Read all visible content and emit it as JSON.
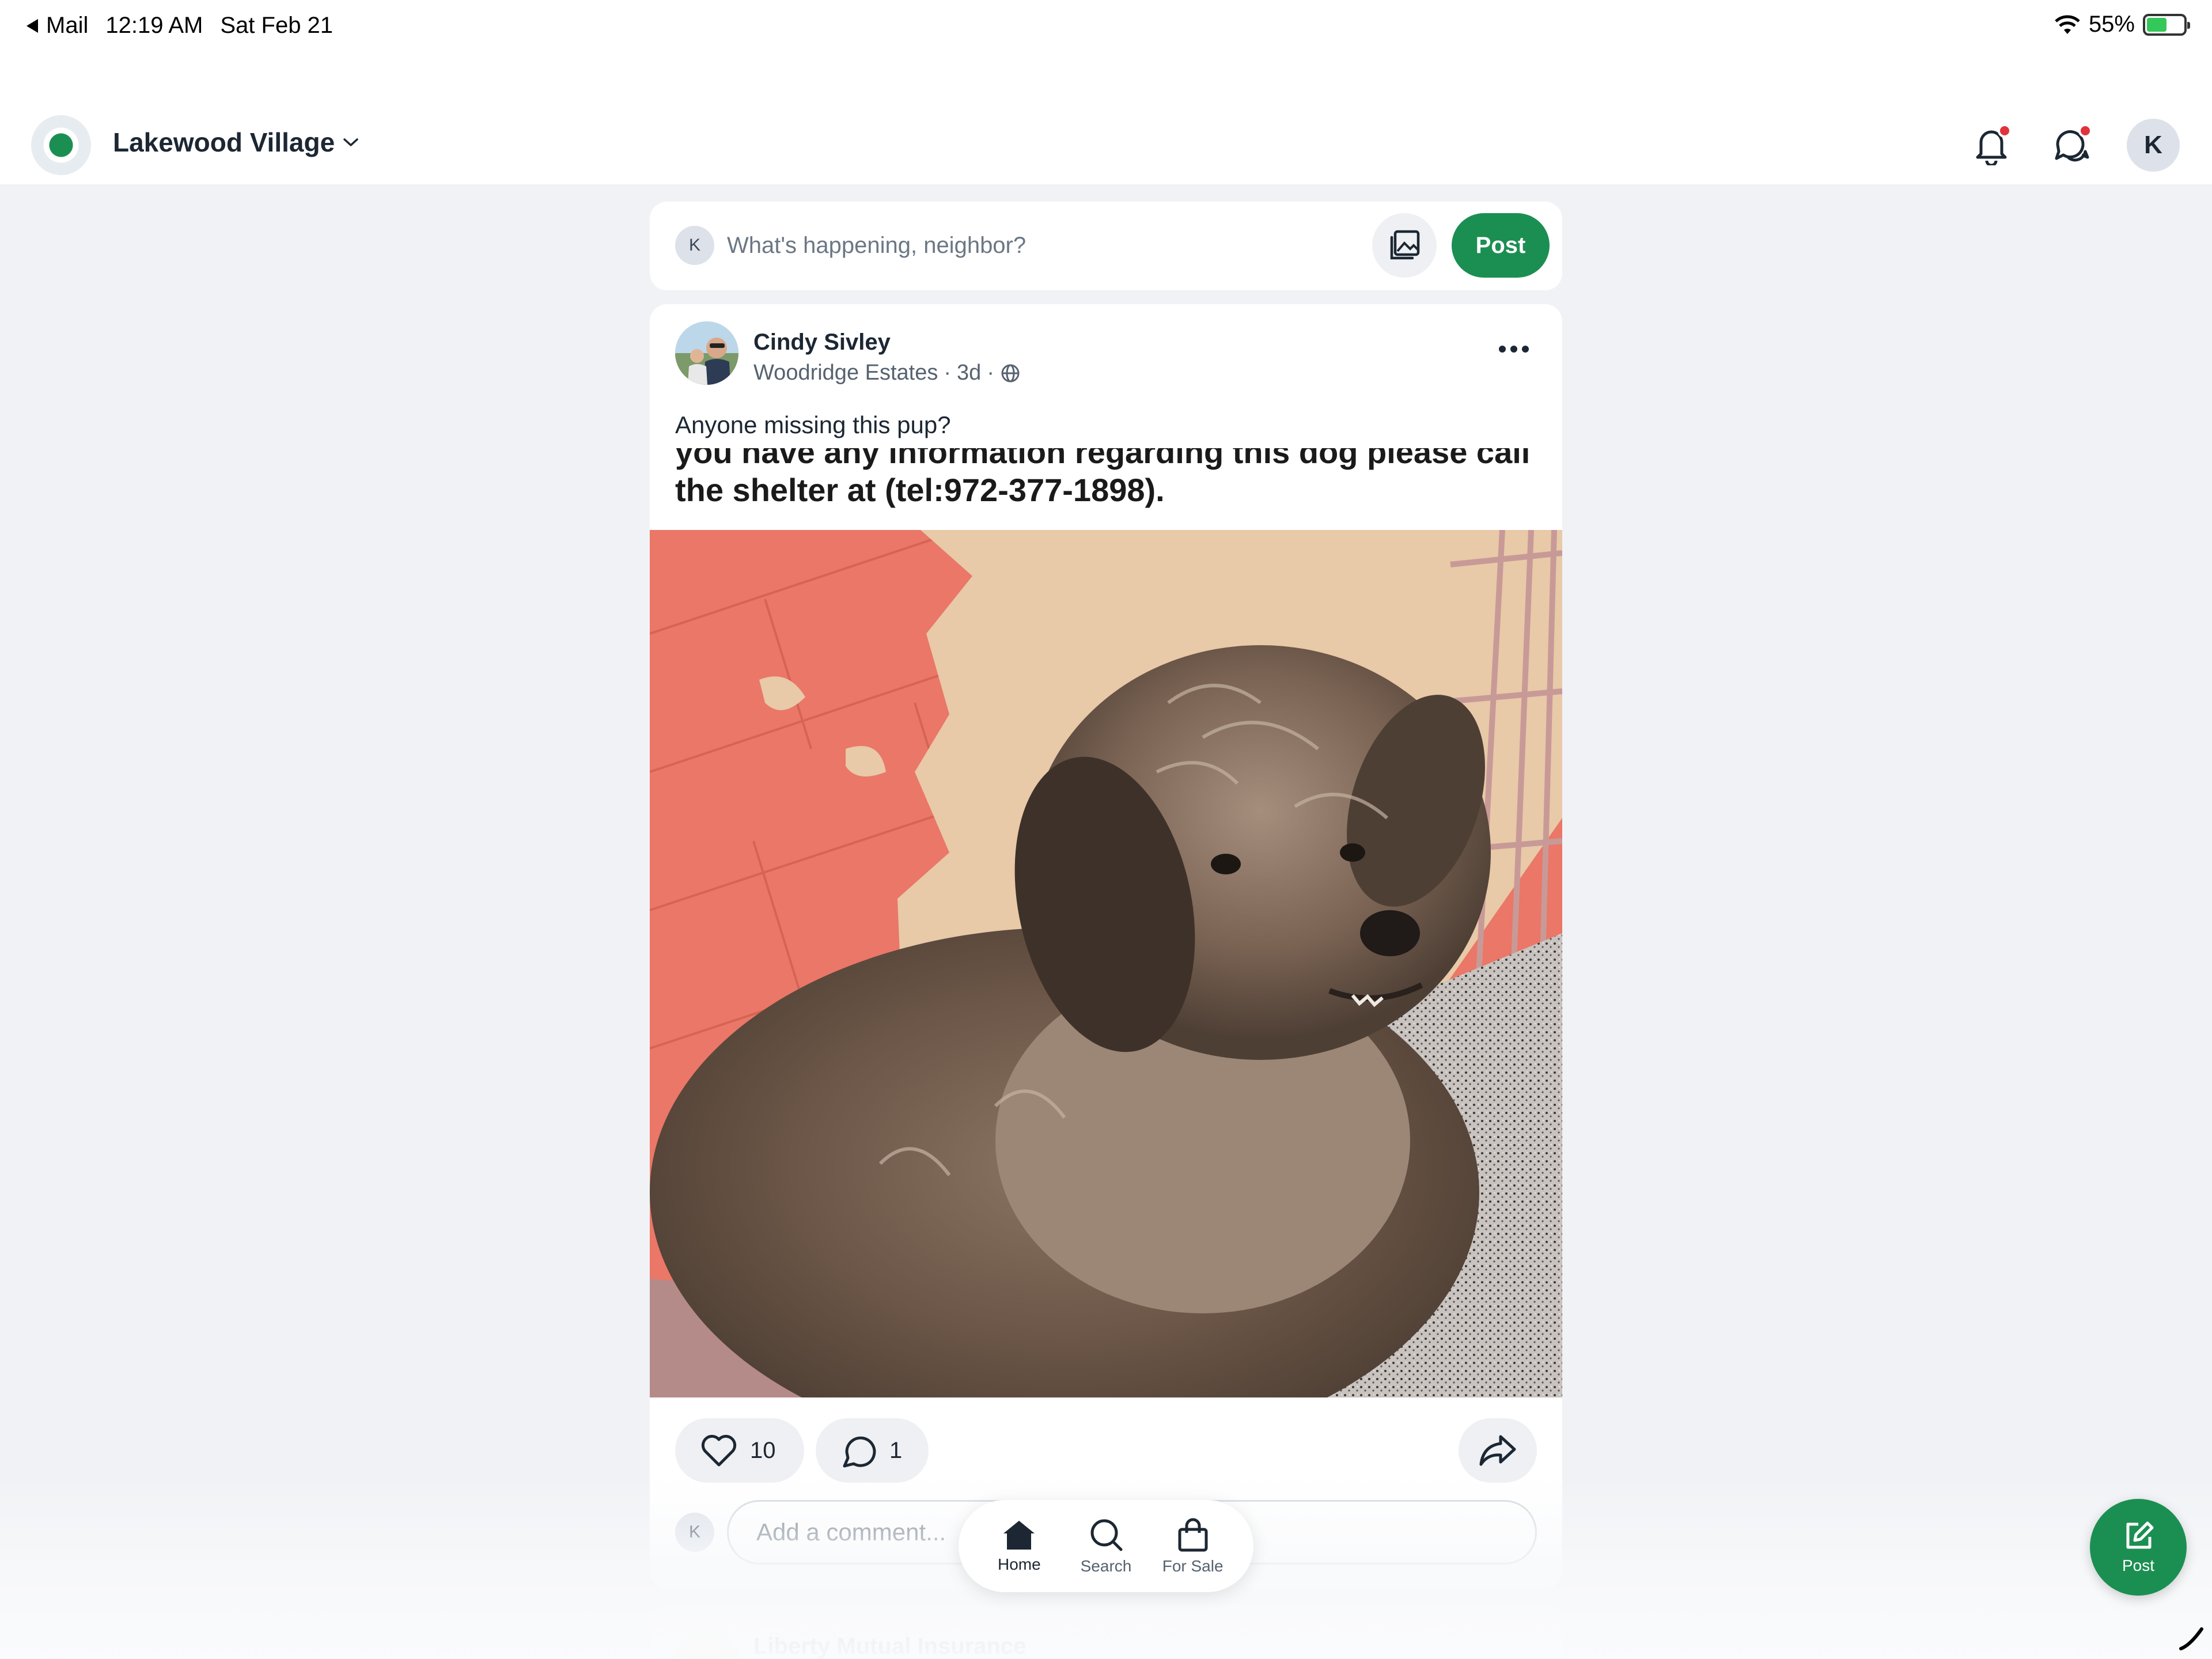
{
  "status_bar": {
    "back_app": "Mail",
    "time": "12:19 AM",
    "date": "Sat Feb 21",
    "battery_percent": "55%",
    "battery_level": 0.55
  },
  "header": {
    "community_name": "Lakewood Village",
    "notifications_has_badge": true,
    "messages_has_badge": true,
    "profile_initial": "K"
  },
  "composer": {
    "user_initial": "K",
    "placeholder": "What's happening, neighbor?",
    "post_label": "Post"
  },
  "post": {
    "author_name": "Cindy Sivley",
    "author_neighborhood": "Woodridge Estates",
    "age": "3d",
    "text": "Anyone missing this pup?",
    "image_caption_line1": "you have any information regarding this dog please call",
    "image_caption_line2": "the shelter at (tel:972-377-1898).",
    "like_count": "10",
    "comment_count": "1",
    "comment_placeholder": "Add a comment...",
    "commenter_initial": "K"
  },
  "next_post": {
    "author_name": "Liberty Mutual Insurance"
  },
  "bottom_nav": {
    "items": [
      {
        "label": "Home",
        "icon": "home-icon",
        "active": true
      },
      {
        "label": "Search",
        "icon": "search-icon",
        "active": false
      },
      {
        "label": "For Sale",
        "icon": "shopping-bag-icon",
        "active": false
      }
    ]
  },
  "fab": {
    "label": "Post",
    "icon": "compose-icon"
  },
  "colors": {
    "brand_green": "#1b8f52",
    "badge_red": "#e0333b",
    "background": "#f0f2f5"
  }
}
